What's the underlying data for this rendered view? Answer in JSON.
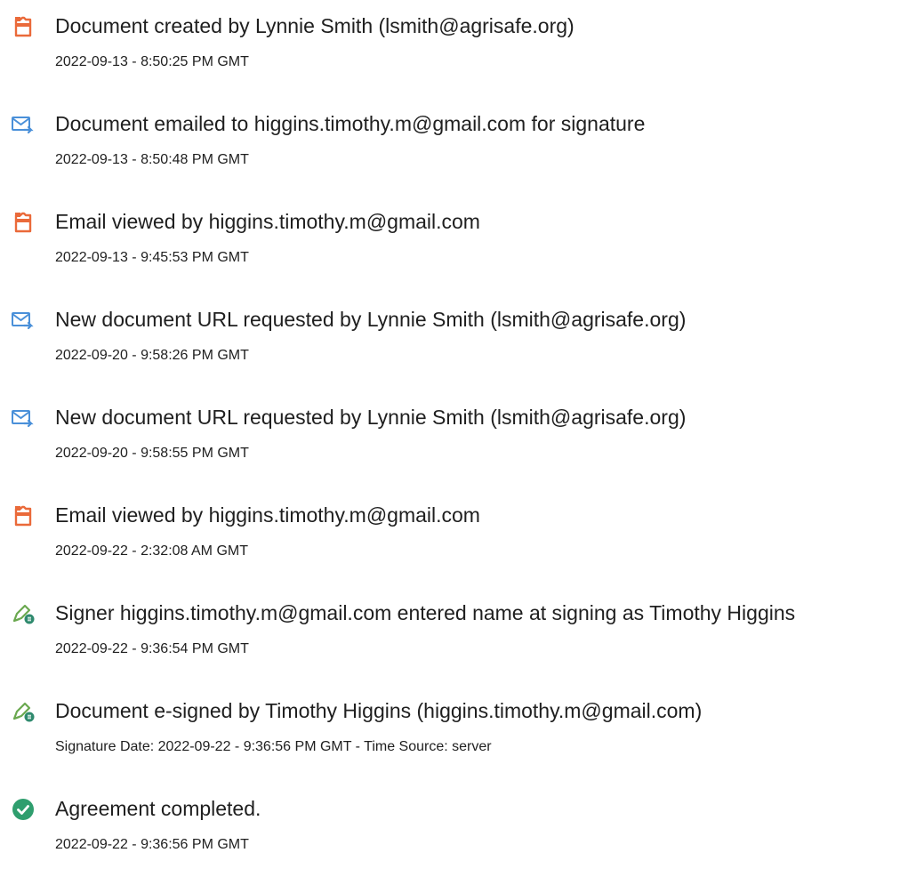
{
  "audit_events": [
    {
      "icon": "document-created-icon",
      "title": "Document created by Lynnie Smith (lsmith@agrisafe.org)",
      "timestamp": "2022-09-13 - 8:50:25 PM GMT"
    },
    {
      "icon": "email-sent-icon",
      "title": "Document emailed to higgins.timothy.m@gmail.com for signature",
      "timestamp": "2022-09-13 - 8:50:48 PM GMT"
    },
    {
      "icon": "document-viewed-icon",
      "title": "Email viewed by higgins.timothy.m@gmail.com",
      "timestamp": "2022-09-13 - 9:45:53 PM GMT"
    },
    {
      "icon": "email-sent-icon",
      "title": "New document URL requested by Lynnie Smith (lsmith@agrisafe.org)",
      "timestamp": "2022-09-20 - 9:58:26 PM GMT"
    },
    {
      "icon": "email-sent-icon",
      "title": "New document URL requested by Lynnie Smith (lsmith@agrisafe.org)",
      "timestamp": "2022-09-20 - 9:58:55 PM GMT"
    },
    {
      "icon": "document-viewed-icon",
      "title": "Email viewed by higgins.timothy.m@gmail.com",
      "timestamp": "2022-09-22 - 2:32:08 AM GMT"
    },
    {
      "icon": "e-sign-pen-icon",
      "title": "Signer higgins.timothy.m@gmail.com entered name at signing as Timothy Higgins",
      "timestamp": "2022-09-22 - 9:36:54 PM GMT"
    },
    {
      "icon": "e-sign-pen-icon",
      "title": "Document e-signed by Timothy Higgins (higgins.timothy.m@gmail.com)",
      "timestamp": "Signature Date: 2022-09-22 - 9:36:56 PM GMT - Time Source: server"
    },
    {
      "icon": "check-circle-icon",
      "title": "Agreement completed.",
      "timestamp": "2022-09-22 - 9:36:56 PM GMT"
    }
  ],
  "colors": {
    "document_icon": "#ea6a3a",
    "email_icon": "#4a90d9",
    "pen_icon": "#6aa84f",
    "pen_badge": "#2f8a6e",
    "check_icon": "#2f9e6e",
    "text": "#1f1f1f"
  }
}
